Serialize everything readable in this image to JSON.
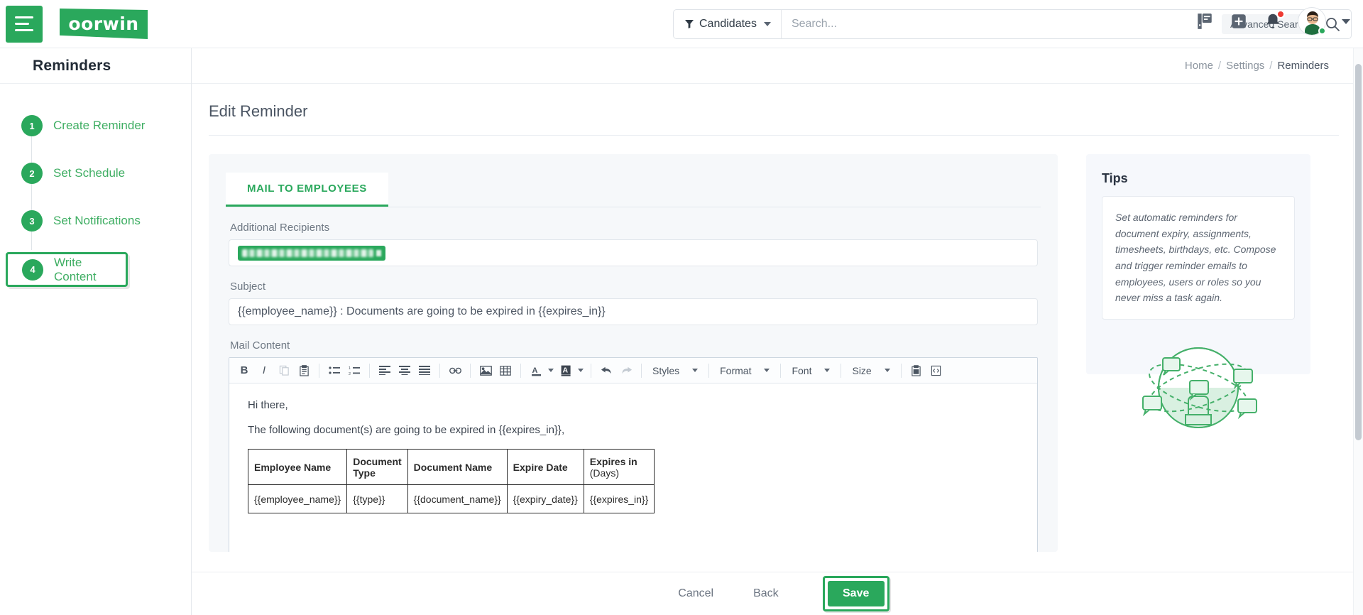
{
  "header": {
    "logo_text": "oorwin",
    "menu_icon": "hamburger-icon",
    "filter_label": "Candidates",
    "search_placeholder": "Search...",
    "search_value": "",
    "advanced_search_label": "Advanced Search",
    "icons": [
      "filter-icon",
      "search-icon",
      "notes-icon",
      "add-icon",
      "bell-icon",
      "avatar"
    ],
    "notification_badge": true
  },
  "sidebar": {
    "title": "Reminders",
    "steps": [
      {
        "num": "1",
        "label": "Create Reminder",
        "active": false
      },
      {
        "num": "2",
        "label": "Set Schedule",
        "active": false
      },
      {
        "num": "3",
        "label": "Set Notifications",
        "active": false
      },
      {
        "num": "4",
        "label": "Write Content",
        "active": true
      }
    ]
  },
  "breadcrumb": {
    "home": "Home",
    "settings": "Settings",
    "current": "Reminders",
    "separator": "/"
  },
  "main": {
    "page_title": "Edit Reminder",
    "tab_label": "MAIL TO EMPLOYEES",
    "recipients_label": "Additional Recipients",
    "recipients_chip_redacted": true,
    "subject_label": "Subject",
    "subject_value": "{{employee_name}} : Documents are going to be expired in {{expires_in}}",
    "mail_content_label": "Mail Content",
    "toolbar": {
      "buttons": [
        "bold",
        "italic",
        "copy",
        "paste",
        "bulleted-list",
        "numbered-list",
        "align-left",
        "align-center",
        "justify",
        "link",
        "image",
        "table",
        "text-color",
        "background-color",
        "undo",
        "redo",
        "paste-from-word",
        "source-code"
      ],
      "dropdowns": [
        "Styles",
        "Format",
        "Font",
        "Size"
      ]
    },
    "editor": {
      "greeting": "Hi there,",
      "intro": "The following document(s) are going to be expired in {{expires_in}},",
      "table": {
        "headers": [
          "Employee Name",
          "Document Type",
          "Document Name",
          "Expire Date",
          "Expires in"
        ],
        "header_sub": "(Days)",
        "rows": [
          [
            "{{employee_name}}",
            "{{type}}",
            "{{document_name}}",
            "{{expiry_date}}",
            "{{expires_in}}"
          ]
        ]
      }
    }
  },
  "tips": {
    "heading": "Tips",
    "text": "Set automatic reminders for document expiry, assignments, timesheets, birthdays, etc. Compose and trigger reminder emails to employees, users or roles so you never miss a task again.",
    "illustration": "globe-network-illustration"
  },
  "footer": {
    "cancel": "Cancel",
    "back": "Back",
    "save": "Save",
    "save_highlighted": true
  },
  "colors": {
    "brand_green": "#2aa85c",
    "panel_bg": "#f6f8fa",
    "tips_bg": "#f6f8fc",
    "text_dark": "#2b3442",
    "alert_red": "#ee3b33"
  }
}
